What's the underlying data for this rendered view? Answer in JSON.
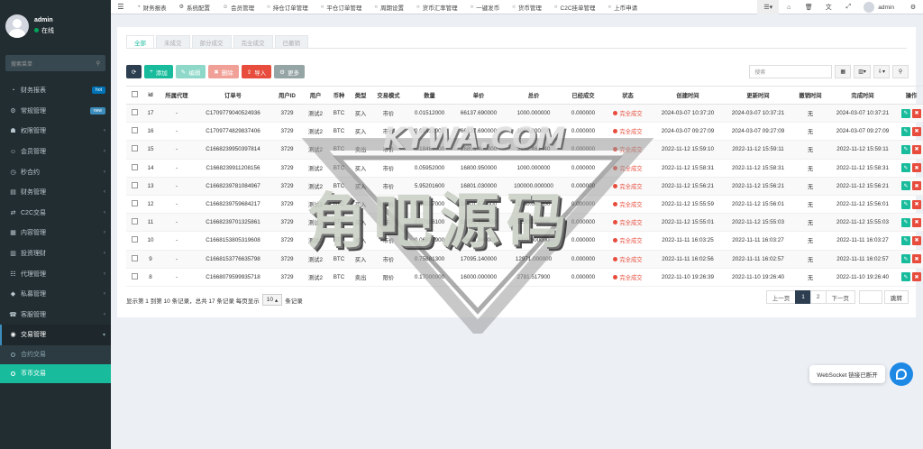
{
  "sidebar": {
    "user_name": "admin",
    "user_status": "在线",
    "search_placeholder": "搜索菜单",
    "items": [
      {
        "label": "财务报表",
        "icon": "dashboard-icon",
        "glyph": "◔",
        "badge": "hot"
      },
      {
        "label": "常规管理",
        "icon": "cogs-icon",
        "glyph": "⚙",
        "badge": "new"
      },
      {
        "label": "权限管理",
        "icon": "users-icon",
        "glyph": "☗",
        "badge": ""
      },
      {
        "label": "会员管理",
        "icon": "user-icon",
        "glyph": "☺",
        "badge": ""
      },
      {
        "label": "秒合约",
        "icon": "clock-icon",
        "glyph": "◷",
        "badge": ""
      },
      {
        "label": "财务管理",
        "icon": "money-icon",
        "glyph": "▤",
        "badge": ""
      },
      {
        "label": "C2C交易",
        "icon": "exchange-icon",
        "glyph": "⇄",
        "badge": ""
      },
      {
        "label": "内容管理",
        "icon": "file-icon",
        "glyph": "▦",
        "badge": ""
      },
      {
        "label": "投资理财",
        "icon": "chart-icon",
        "glyph": "▥",
        "badge": ""
      },
      {
        "label": "代理管理",
        "icon": "sitemap-icon",
        "glyph": "☷",
        "badge": ""
      },
      {
        "label": "私募管理",
        "icon": "diamond-icon",
        "glyph": "◆",
        "badge": ""
      },
      {
        "label": "客服管理",
        "icon": "headset-icon",
        "glyph": "☎",
        "badge": ""
      },
      {
        "label": "交易管理",
        "icon": "eye-icon",
        "glyph": "◉",
        "badge": ""
      }
    ],
    "subitems": [
      "合约交易",
      "币币交易"
    ]
  },
  "navbar": {
    "tabs": [
      {
        "label": "财务报表",
        "icon": "dashboard-icon",
        "glyph": "◔"
      },
      {
        "label": "系统配置",
        "icon": "cogs-icon",
        "glyph": "⚙"
      },
      {
        "label": "会员管理",
        "icon": "user-icon",
        "glyph": "☺"
      },
      {
        "label": "持仓订单管理",
        "icon": "circle-icon",
        "glyph": "○"
      },
      {
        "label": "平仓订单管理",
        "icon": "circle-icon",
        "glyph": "○"
      },
      {
        "label": "周期设置",
        "icon": "circle-icon",
        "glyph": "○"
      },
      {
        "label": "货币汇率管理",
        "icon": "circle-icon",
        "glyph": "○"
      },
      {
        "label": "一键发币",
        "icon": "circle-icon",
        "glyph": "○"
      },
      {
        "label": "货币管理",
        "icon": "circle-icon",
        "glyph": "○"
      },
      {
        "label": "C2C挂单管理",
        "icon": "circle-icon",
        "glyph": "○"
      },
      {
        "label": "上币申请",
        "icon": "circle-icon",
        "glyph": "○"
      }
    ],
    "user": "admin"
  },
  "tabs": [
    "全部",
    "未成交",
    "部分成交",
    "完全成交",
    "已撤销"
  ],
  "toolbar": {
    "add": "添加",
    "edit": "编辑",
    "delete": "删除",
    "import": "导入",
    "more": "更多"
  },
  "search_placeholder": "搜索",
  "columns": [
    "id",
    "所属代理",
    "订单号",
    "用户ID",
    "用户",
    "币种",
    "类型",
    "交易模式",
    "数量",
    "单价",
    "总价",
    "已经成交",
    "状态",
    "创建时间",
    "更新时间",
    "撤销时间",
    "完成时间",
    "操作"
  ],
  "rows": [
    {
      "id": "17",
      "agent": "-",
      "order": "C1709779040524936",
      "uid": "3729",
      "user": "测试2",
      "coin": "BTC",
      "type": "买入",
      "type_class": "st-buy",
      "mode": "市价",
      "mode_class": "",
      "qty": "0.01512000",
      "price": "66137.690000",
      "total": "1000.000000",
      "filled": "0.000000",
      "status": "完全成交",
      "created": "2024-03-07 10:37:20",
      "updated": "2024-03-07 10:37:21",
      "cancel": "无",
      "done": "2024-03-07 10:37:21"
    },
    {
      "id": "16",
      "agent": "-",
      "order": "C1709774829837406",
      "uid": "3729",
      "user": "测试2",
      "coin": "BTC",
      "type": "买入",
      "type_class": "st-buy",
      "mode": "市价",
      "mode_class": "",
      "qty": "0.01512000",
      "price": "66137.690000",
      "total": "1000.000000",
      "filled": "0.000000",
      "status": "完全成交",
      "created": "2024-03-07 09:27:09",
      "updated": "2024-03-07 09:27:09",
      "cancel": "无",
      "done": "2024-03-07 09:27:09"
    },
    {
      "id": "15",
      "agent": "-",
      "order": "C1668239950397814",
      "uid": "3729",
      "user": "测试2",
      "coin": "BTC",
      "type": "卖出",
      "type_class": "st-sell",
      "mode": "市价",
      "mode_class": "",
      "qty": "0.18460000",
      "price": "16806.400000",
      "total": "3102.461440",
      "filled": "0.000000",
      "status": "完全成交",
      "created": "2022-11-12 15:59:10",
      "updated": "2022-11-12 15:59:11",
      "cancel": "无",
      "done": "2022-11-12 15:59:11"
    },
    {
      "id": "14",
      "agent": "-",
      "order": "C1668239911208156",
      "uid": "3729",
      "user": "测试2",
      "coin": "BTC",
      "type": "买入",
      "type_class": "st-buy",
      "mode": "市价",
      "mode_class": "",
      "qty": "0.05952000",
      "price": "16800.950000",
      "total": "1000.000000",
      "filled": "0.000000",
      "status": "完全成交",
      "created": "2022-11-12 15:58:31",
      "updated": "2022-11-12 15:58:31",
      "cancel": "无",
      "done": "2022-11-12 15:58:31"
    },
    {
      "id": "13",
      "agent": "-",
      "order": "C1668239781084967",
      "uid": "3729",
      "user": "测试2",
      "coin": "BTC",
      "type": "买入",
      "type_class": "st-buy",
      "mode": "市价",
      "mode_class": "",
      "qty": "5.95201600",
      "price": "16801.030000",
      "total": "100000.000000",
      "filled": "0.000000",
      "status": "完全成交",
      "created": "2022-11-12 15:56:21",
      "updated": "2022-11-12 15:56:21",
      "cancel": "无",
      "done": "2022-11-12 15:56:21"
    },
    {
      "id": "12",
      "agent": "-",
      "order": "C1668239759684217",
      "uid": "3729",
      "user": "测试2",
      "coin": "BTC",
      "type": "买入",
      "type_class": "st-buy",
      "mode": "市价",
      "mode_class": "",
      "qty": "0.05517000",
      "price": "16801.670000",
      "total": "1000.000000",
      "filled": "0.000000",
      "status": "完全成交",
      "created": "2022-11-12 15:55:59",
      "updated": "2022-11-12 15:56:01",
      "cancel": "无",
      "done": "2022-11-12 15:56:01"
    },
    {
      "id": "11",
      "agent": "-",
      "order": "C1668239701325861",
      "uid": "3729",
      "user": "测试2",
      "coin": "BTC",
      "type": "买入",
      "type_class": "st-buy",
      "mode": "市价",
      "mode_class": "",
      "qty": "0.07326100",
      "price": "16791.650000",
      "total": "1230.000000",
      "filled": "0.000000",
      "status": "完全成交",
      "created": "2022-11-12 15:55:01",
      "updated": "2022-11-12 15:55:03",
      "cancel": "无",
      "done": "2022-11-12 15:55:03"
    },
    {
      "id": "10",
      "agent": "-",
      "order": "C1668153805319608",
      "uid": "3729",
      "user": "测试2",
      "coin": "BTC",
      "type": "买入",
      "type_class": "st-buy",
      "mode": "市价",
      "mode_class": "",
      "qty": "0.06830900",
      "price": "16806.940000",
      "total": "1111.000000",
      "filled": "0.000000",
      "status": "完全成交",
      "created": "2022-11-11 16:03:25",
      "updated": "2022-11-11 16:03:27",
      "cancel": "无",
      "done": "2022-11-11 16:03:27"
    },
    {
      "id": "9",
      "agent": "-",
      "order": "C1668153776635798",
      "uid": "3729",
      "user": "测试2",
      "coin": "BTC",
      "type": "买入",
      "type_class": "st-buy",
      "mode": "市价",
      "mode_class": "",
      "qty": "0.75881300",
      "price": "17095.140000",
      "total": "12971.000000",
      "filled": "0.000000",
      "status": "完全成交",
      "created": "2022-11-11 16:02:56",
      "updated": "2022-11-11 16:02:57",
      "cancel": "无",
      "done": "2022-11-11 16:02:57"
    },
    {
      "id": "8",
      "agent": "-",
      "order": "C1668079599935718",
      "uid": "3729",
      "user": "测试2",
      "coin": "BTC",
      "type": "卖出",
      "type_class": "st-sell",
      "mode": "限价",
      "mode_class": "mode-limit",
      "qty": "0.17000000",
      "price": "16000.000000",
      "total": "2781.517900",
      "filled": "0.000000",
      "status": "完全成交",
      "created": "2022-11-10 19:26:39",
      "updated": "2022-11-10 19:26:40",
      "cancel": "无",
      "done": "2022-11-10 19:26:40"
    }
  ],
  "footer": {
    "info": "显示第 1 到第 10 条记录，总共 17 条记录 每页显示",
    "page_size": "10",
    "suffix": "条记录"
  },
  "pager": {
    "prev": "上一页",
    "pages": [
      "1",
      "2"
    ],
    "next": "下一页",
    "jump": "跳转"
  },
  "watermark": {
    "title": "角吧源码",
    "sub": "KYWA.COM"
  },
  "websocket": {
    "message": "WebSocket 链接已断开"
  },
  "colors": {
    "sidebar_bg": "#222d32",
    "accent": "#18bc9c",
    "danger": "#e74c3c",
    "dark": "#2c3e50"
  }
}
